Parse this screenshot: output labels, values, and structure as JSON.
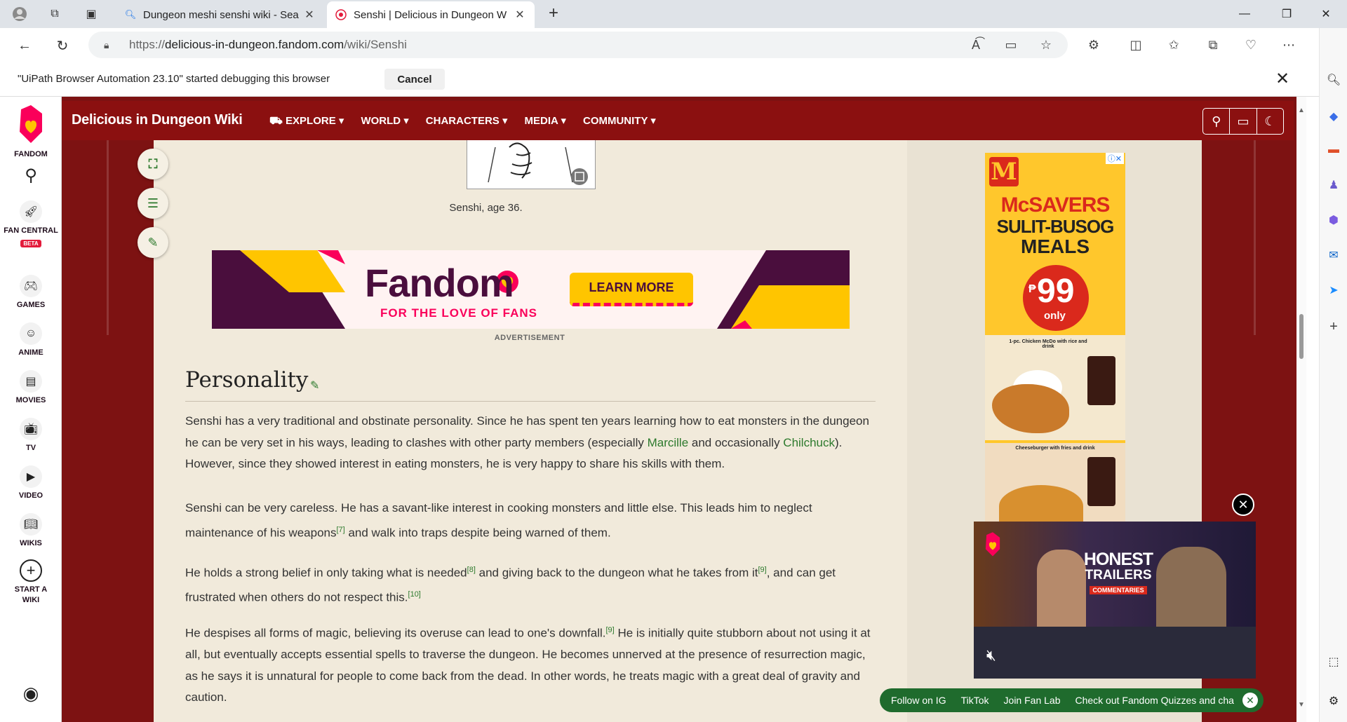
{
  "browser": {
    "tabs": [
      {
        "title": "Dungeon meshi senshi wiki - Sea",
        "favicon": "search-icon"
      },
      {
        "title": "Senshi | Delicious in Dungeon W",
        "favicon": "fandom-icon"
      }
    ],
    "url_prefix": "https://",
    "url_host": "delicious-in-dungeon.fandom.com",
    "url_path": "/wiki/Senshi",
    "infobar_message": "\"UiPath Browser Automation 23.10\" started debugging this browser",
    "infobar_cancel": "Cancel"
  },
  "fandom_rail": {
    "logo_label": "FANDOM",
    "items": [
      {
        "label": "FAN CENTRAL",
        "badge": "BETA",
        "icon": "rocket-icon"
      },
      {
        "label": "GAMES",
        "icon": "gamepad-icon"
      },
      {
        "label": "ANIME",
        "icon": "anime-icon"
      },
      {
        "label": "MOVIES",
        "icon": "movies-icon"
      },
      {
        "label": "TV",
        "icon": "tv-icon"
      },
      {
        "label": "VIDEO",
        "icon": "video-icon"
      },
      {
        "label": "WIKIS",
        "icon": "wikis-icon"
      },
      {
        "label": "START A WIKI",
        "icon": "plus-icon"
      }
    ]
  },
  "wiki": {
    "title": "Delicious in Dungeon Wiki",
    "nav": [
      "EXPLORE",
      "WORLD",
      "CHARACTERS",
      "MEDIA",
      "COMMUNITY"
    ]
  },
  "article": {
    "image_caption": "Senshi, age 36.",
    "ad": {
      "brand": "Fandom",
      "tagline": "FOR THE LOVE OF FANS",
      "cta": "LEARN MORE",
      "label": "ADVERTISEMENT"
    },
    "section_title": "Personality",
    "p1": {
      "a": "Senshi has a very traditional and obstinate personality. Since he has spent ten years learning how to eat monsters in the dungeon he can be very set in his ways, leading to clashes with other party members (especially ",
      "link1": "Marcille",
      "b": " and occasionally ",
      "link2": "Chilchuck",
      "c": "). However, since they showed interest in eating monsters, he is very happy to share his skills with them."
    },
    "p2": {
      "a": "Senshi can be very careless. He has a savant-like interest in cooking monsters and little else. This leads him to neglect maintenance of his weapons",
      "ref1": "[7]",
      "b": " and walk into traps despite being warned of them."
    },
    "p3": {
      "a": "He holds a strong belief in only taking what is needed",
      "ref1": "[8]",
      "b": " and giving back to the dungeon what he takes from it",
      "ref2": "[9]",
      "c": ", and can get frustrated when others do not respect this.",
      "ref3": "[10]"
    },
    "p4": {
      "a": "He despises all forms of magic, believing its overuse can lead to one's downfall.",
      "ref1": "[9]",
      "b": " He is initially quite stubborn about not using it at all, but eventually accepts essential spells to traverse the dungeon. He becomes unnerved at the presence of resurrection magic, as he says it is unnatural for people to come back from the dead. In other words, he treats magic with a great deal of gravity and caution."
    }
  },
  "side_ad": {
    "line1": "McSAVERS",
    "line2": "SULIT-BUSOG",
    "line3": "MEALS",
    "currency": "₱",
    "price": "99",
    "price_note": "only",
    "item1": "1-pc. Chicken McDo with rice and drink",
    "item2": "Cheeseburger with fries and drink"
  },
  "video": {
    "title1": "HONEST",
    "title2": "TRAILERS",
    "subtitle": "COMMENTARIES"
  },
  "bottom_bar": [
    "Follow on IG",
    "TikTok",
    "Join Fan Lab",
    "Check out Fandom Quizzes and cha"
  ],
  "colors": {
    "wiki_header": "#8b1010",
    "page_bg": "#7d1212",
    "content_bg": "#f1eadb",
    "link": "#2d7a2d",
    "fandom_pink": "#fa005a"
  }
}
